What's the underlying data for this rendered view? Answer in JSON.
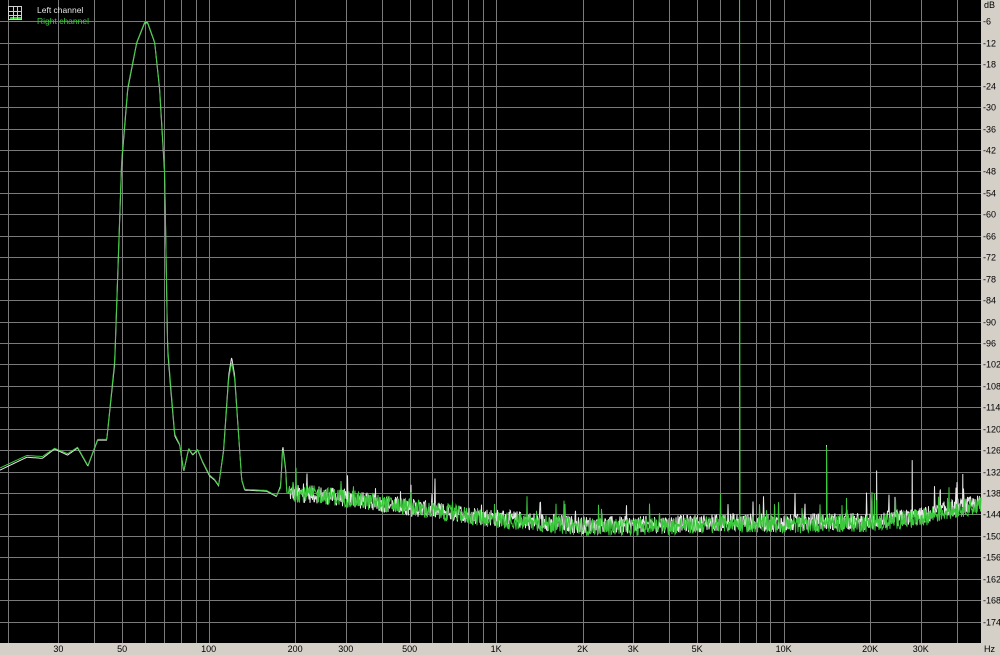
{
  "chart_data": {
    "type": "line",
    "title": "",
    "xlabel": "Hz",
    "ylabel": "dB",
    "x_scale": "log",
    "xlim": [
      18.8,
      48600
    ],
    "ylim": [
      -180,
      0
    ],
    "grid": true,
    "legend_position": "top-left",
    "x_tick_labels": [
      {
        "value": 30,
        "label": "30"
      },
      {
        "value": 50,
        "label": "50"
      },
      {
        "value": 100,
        "label": "100"
      },
      {
        "value": 200,
        "label": "200"
      },
      {
        "value": 300,
        "label": "300"
      },
      {
        "value": 500,
        "label": "500"
      },
      {
        "value": 1000,
        "label": "1K"
      },
      {
        "value": 2000,
        "label": "2K"
      },
      {
        "value": 3000,
        "label": "3K"
      },
      {
        "value": 5000,
        "label": "5K"
      },
      {
        "value": 10000,
        "label": "10K"
      },
      {
        "value": 20000,
        "label": "20K"
      },
      {
        "value": 30000,
        "label": "30K"
      }
    ],
    "y_ticks": [
      -6,
      -12,
      -18,
      -24,
      -30,
      -36,
      -42,
      -48,
      -54,
      -60,
      -66,
      -72,
      -78,
      -84,
      -90,
      -96,
      -102,
      -108,
      -114,
      -120,
      -126,
      -132,
      -138,
      -144,
      -150,
      -156,
      -162,
      -168,
      -174
    ],
    "series": [
      {
        "name": "Left channel",
        "color": "#e6e6e6",
        "points": [
          [
            18.8,
            -131.6
          ],
          [
            23.3,
            -128
          ],
          [
            26.4,
            -128.3
          ],
          [
            29.1,
            -125.7
          ],
          [
            32.3,
            -127.4
          ],
          [
            35,
            -125.4
          ],
          [
            38,
            -130.5
          ],
          [
            41.1,
            -123.2
          ],
          [
            44.2,
            -123.2
          ],
          [
            47.1,
            -102
          ],
          [
            49.8,
            -46
          ],
          [
            52.3,
            -25
          ],
          [
            56.2,
            -12
          ],
          [
            59.9,
            -6.4
          ],
          [
            61.3,
            -6.4
          ],
          [
            64.9,
            -12
          ],
          [
            67.5,
            -25
          ],
          [
            70.3,
            -49
          ],
          [
            72,
            -98
          ],
          [
            73.8,
            -109
          ],
          [
            76.2,
            -122
          ],
          [
            79.3,
            -124.6
          ],
          [
            81.9,
            -132
          ],
          [
            85.2,
            -125.7
          ],
          [
            88,
            -127.4
          ],
          [
            91.6,
            -126
          ],
          [
            95.3,
            -129.4
          ],
          [
            100.8,
            -133.3
          ],
          [
            104.9,
            -134.4
          ],
          [
            108.3,
            -136
          ],
          [
            112.7,
            -126
          ],
          [
            117.4,
            -105
          ],
          [
            120.2,
            -100
          ],
          [
            123.1,
            -105
          ],
          [
            126.1,
            -117.6
          ],
          [
            130.3,
            -134.4
          ],
          [
            133.5,
            -137.2
          ],
          [
            159,
            -137.5
          ],
          [
            172,
            -139
          ],
          [
            178,
            -136
          ],
          [
            181,
            -124.6
          ],
          [
            185.5,
            -131.6
          ],
          [
            187,
            -138
          ],
          [
            243,
            -138.5
          ],
          [
            300,
            -139.5
          ],
          [
            500,
            -142
          ],
          [
            1000,
            -145
          ],
          [
            2000,
            -147
          ],
          [
            3000,
            -147
          ],
          [
            5000,
            -146.5
          ],
          [
            6500,
            -146
          ],
          [
            10000,
            -146.5
          ],
          [
            14000,
            -146
          ],
          [
            20000,
            -146
          ],
          [
            30000,
            -144.5
          ],
          [
            40000,
            -142
          ],
          [
            48600,
            -141
          ]
        ],
        "spikes": [
          [
            7030,
            -106
          ],
          [
            14100,
            -124.6
          ],
          [
            21060,
            -131.7
          ],
          [
            28000,
            -128.8
          ],
          [
            35100,
            -137
          ],
          [
            42000,
            -132.7
          ]
        ]
      },
      {
        "name": "Right channel",
        "color": "#3cc83c",
        "points": [
          [
            18.8,
            -131
          ],
          [
            23.3,
            -127.5
          ],
          [
            26.4,
            -127.8
          ],
          [
            29.1,
            -125.5
          ],
          [
            32.3,
            -127
          ],
          [
            35,
            -125.2
          ],
          [
            38,
            -130.3
          ],
          [
            41.1,
            -123
          ],
          [
            44.2,
            -123
          ],
          [
            47.1,
            -101
          ],
          [
            49.8,
            -45
          ],
          [
            52.3,
            -24.5
          ],
          [
            56.2,
            -11.8
          ],
          [
            59.9,
            -6.2
          ],
          [
            61.3,
            -6.2
          ],
          [
            64.9,
            -11.8
          ],
          [
            67.5,
            -24.5
          ],
          [
            70.3,
            -48
          ],
          [
            72,
            -97
          ],
          [
            73.8,
            -108
          ],
          [
            76.2,
            -121.5
          ],
          [
            79.3,
            -124.4
          ],
          [
            81.9,
            -131.8
          ],
          [
            85.2,
            -125.5
          ],
          [
            88,
            -127.2
          ],
          [
            91.6,
            -125.8
          ],
          [
            95.3,
            -129.2
          ],
          [
            100.8,
            -133
          ],
          [
            104.9,
            -134.2
          ],
          [
            108.3,
            -135.8
          ],
          [
            112.7,
            -126.5
          ],
          [
            117.4,
            -106
          ],
          [
            120.2,
            -101.5
          ],
          [
            123.1,
            -106
          ],
          [
            126.1,
            -118
          ],
          [
            130.3,
            -134.2
          ],
          [
            133.5,
            -137
          ],
          [
            159,
            -137.3
          ],
          [
            172,
            -138.8
          ],
          [
            178,
            -136.5
          ],
          [
            181,
            -125.5
          ],
          [
            185.5,
            -132
          ],
          [
            187,
            -138
          ],
          [
            243,
            -138.5
          ],
          [
            300,
            -139.5
          ],
          [
            500,
            -142
          ],
          [
            1000,
            -145.5
          ],
          [
            2000,
            -147.5
          ],
          [
            3000,
            -147.5
          ],
          [
            5000,
            -147
          ],
          [
            6500,
            -146.5
          ],
          [
            10000,
            -147
          ],
          [
            14000,
            -146.5
          ],
          [
            20000,
            -146.5
          ],
          [
            30000,
            -145
          ],
          [
            40000,
            -142.5
          ],
          [
            48600,
            -141.5
          ]
        ],
        "spikes": [
          [
            7030,
            0
          ],
          [
            14100,
            -125
          ],
          [
            21060,
            -140
          ],
          [
            28000,
            -143
          ]
        ]
      }
    ]
  }
}
